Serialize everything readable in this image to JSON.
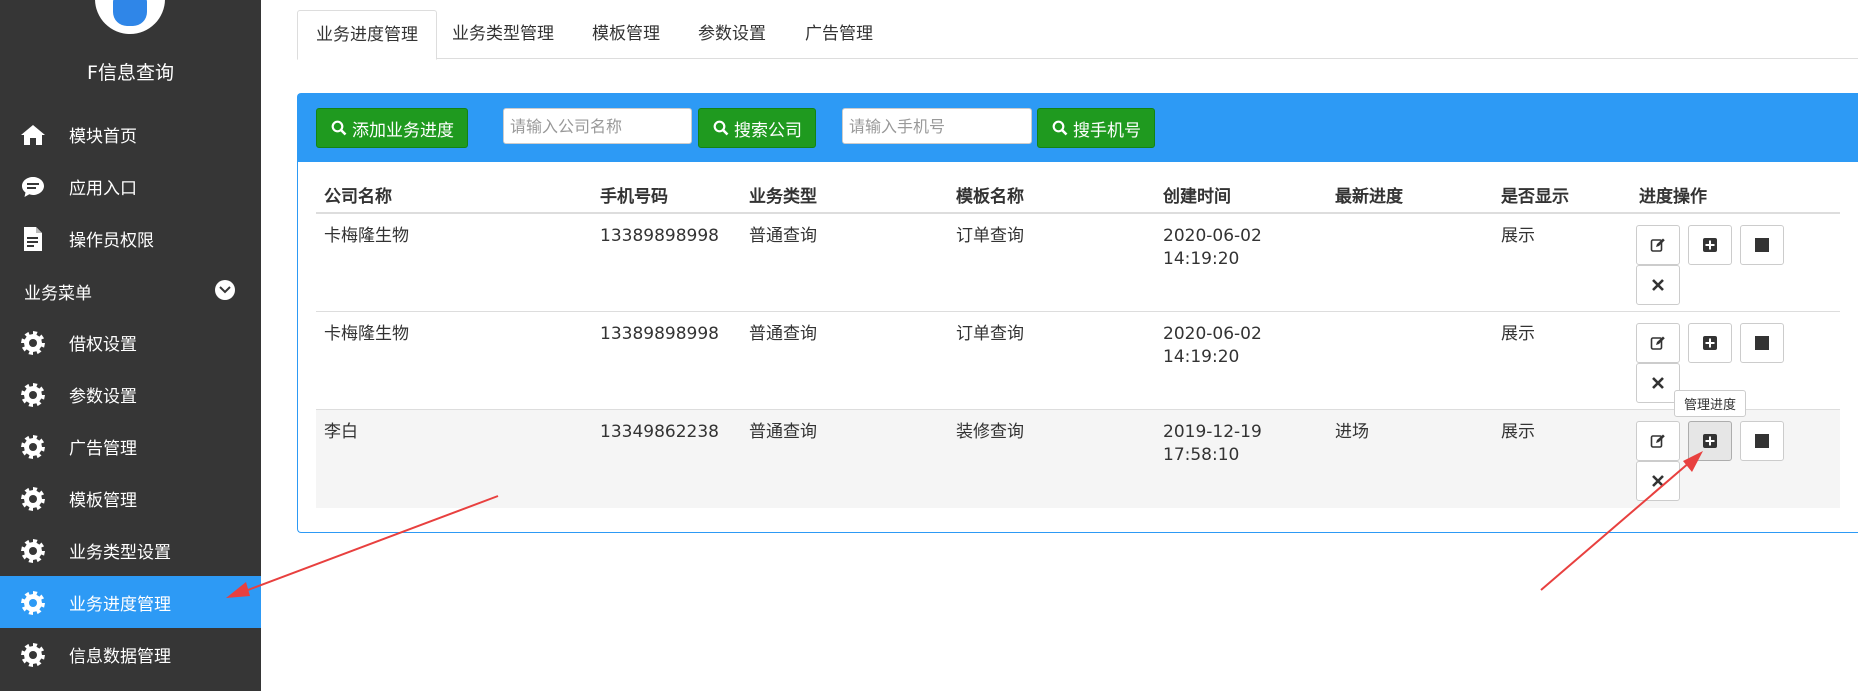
{
  "sidebar": {
    "brand": "F信息查询",
    "items": [
      {
        "label": "模块首页",
        "icon": "home-icon"
      },
      {
        "label": "应用入口",
        "icon": "chat-icon"
      },
      {
        "label": "操作员权限",
        "icon": "document-icon"
      }
    ],
    "group_label": "业务菜单",
    "group_items": [
      {
        "label": "借权设置",
        "icon": "gear-icon"
      },
      {
        "label": "参数设置",
        "icon": "gear-icon"
      },
      {
        "label": "广告管理",
        "icon": "gear-icon"
      },
      {
        "label": "模板管理",
        "icon": "gear-icon"
      },
      {
        "label": "业务类型设置",
        "icon": "gear-icon"
      },
      {
        "label": "业务进度管理",
        "icon": "gear-icon",
        "active": true
      },
      {
        "label": "信息数据管理",
        "icon": "gear-icon"
      }
    ]
  },
  "tabs": [
    "业务进度管理",
    "业务类型管理",
    "模板管理",
    "参数设置",
    "广告管理"
  ],
  "toolbar": {
    "add_label": "添加业务进度",
    "company_placeholder": "请输入公司名称",
    "search_company_label": "搜索公司",
    "phone_placeholder": "请输入手机号",
    "search_phone_label": "搜手机号"
  },
  "table": {
    "headers": [
      "公司名称",
      "手机号码",
      "业务类型",
      "模板名称",
      "创建时间",
      "最新进度",
      "是否显示",
      "进度操作"
    ],
    "rows": [
      {
        "company": "卡梅隆生物",
        "phone": "13389898998",
        "type": "普通查询",
        "template": "订单查询",
        "date": "2020-06-02",
        "time": "14:19:20",
        "progress": "",
        "display": "展示"
      },
      {
        "company": "卡梅隆生物",
        "phone": "13389898998",
        "type": "普通查询",
        "template": "订单查询",
        "date": "2020-06-02",
        "time": "14:19:20",
        "progress": "",
        "display": "展示"
      },
      {
        "company": "李白",
        "phone": "13349862238",
        "type": "普通查询",
        "template": "装修查询",
        "date": "2019-12-19",
        "time": "17:58:10",
        "progress": "进场",
        "display": "展示"
      }
    ]
  },
  "tooltip": "管理进度",
  "colors": {
    "sidebar_bg": "#363636",
    "accent": "#2d9af5",
    "green": "#1f9a1f",
    "annotation_arrow": "#e8403f"
  }
}
